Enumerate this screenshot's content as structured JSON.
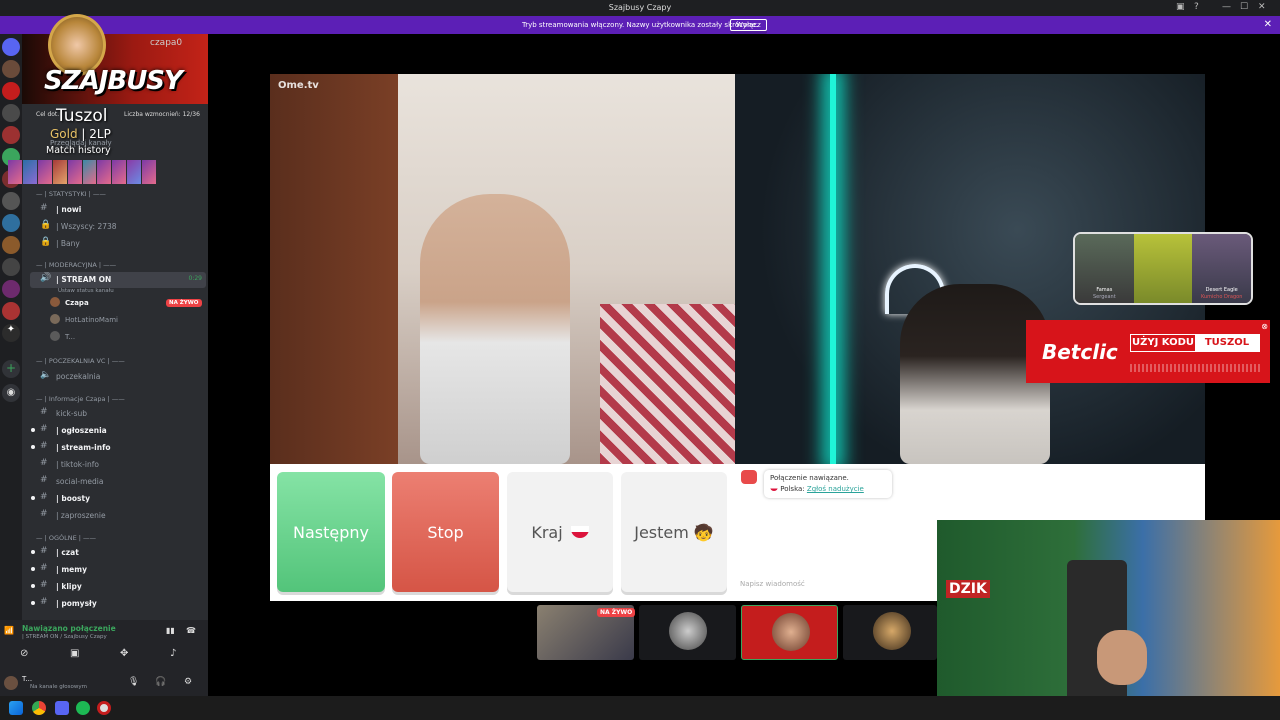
{
  "window": {
    "title": "Szajbusy Czapy"
  },
  "banner": {
    "text": "Tryb streamowania włączony. Nazwy użytkownika zostały skrócone.",
    "button": "Wyłącz"
  },
  "overlay": {
    "game_title": "SZAJBUSY",
    "user": "czapa0",
    "player": "Tuszol",
    "rank": "Gold",
    "lp": "| 2LP",
    "match": "Match history"
  },
  "sidebar": {
    "boost_label": "Cel dot.",
    "boost_count": "Liczba wzmocnień: 12/36",
    "browse": "Przeglądaj kanały",
    "categories": {
      "stats": "— | STATYSTYKI | ——",
      "mod": "— | MODERACYJNA | ——",
      "waiting": "— | POCZEKALNIA VC | ——",
      "info": "— | Informacje Czapa | ——",
      "general": "— | OGÓLNE | ——"
    },
    "channels": {
      "nowi": "| nowi",
      "wszyscy": "| Wszyscy: 2738",
      "bany": "| Bany",
      "stream_on": "| STREAM ON",
      "stream_time": "0:29",
      "status": "Ustaw status kanału",
      "user1": "Czapa",
      "user2": "HotLatinoMami",
      "user3": "T...",
      "live": "NA ŻYWO",
      "poczekalnia": "poczekalnia",
      "kick": "kick-sub",
      "ogloszenia": "| ogłoszenia",
      "stream_info": "| stream-info",
      "tiktok": "| tiktok-info",
      "social": "social-media",
      "boosty": "| boosty",
      "zaproszenie": "| zaproszenie",
      "czat": "| czat",
      "memy": "| memy",
      "klipy": "| klipy",
      "pomysly": "| pomysły"
    },
    "voice": {
      "status": "Nawiązano połączenie",
      "path": "| STREAM ON / Szajbusy Czapy",
      "user": "T...",
      "user_status": "Na kanale głosowym"
    }
  },
  "ome": {
    "logo": "Ome.tv",
    "buttons": {
      "next": "Następny",
      "stop": "Stop",
      "country": "Kraj",
      "jestem": "Jestem"
    },
    "chat": {
      "line1": "Połączenie nawiązane.",
      "line2_prefix": "Polska:",
      "line2_link": "Zgłoś nadużycie",
      "placeholder": "Napisz wiadomość"
    }
  },
  "ad": {
    "brand": "Betclic",
    "code_label": "UŻYJ KODU",
    "code": "TUSZOL"
  },
  "skins": [
    {
      "name": "Famas",
      "sub": "Sergeant"
    },
    {
      "name": "",
      "sub": ""
    },
    {
      "name": "Desert Eagle",
      "sub": "Kumicho Dragon"
    }
  ],
  "cam": {
    "sign": "DZIK"
  },
  "participants": {
    "live": "NA ŻYWO"
  },
  "colors": {
    "banner": "#5c1fb6",
    "next": "#53c47a",
    "stop": "#d55546",
    "betclic": "#d7141a",
    "live": "#ed4245"
  }
}
